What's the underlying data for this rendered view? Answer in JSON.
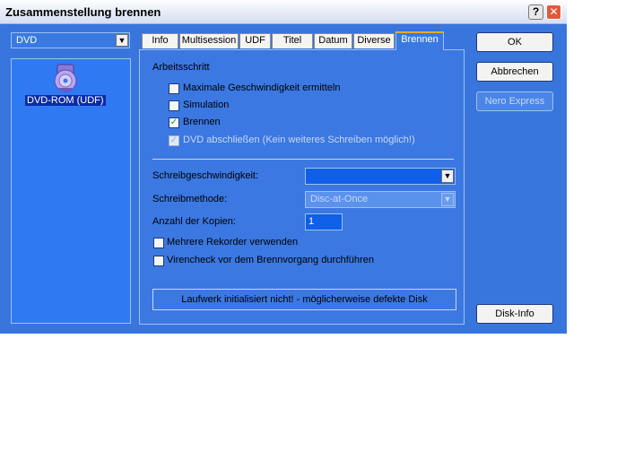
{
  "window": {
    "title": "Zusammenstellung brennen"
  },
  "drive_select": {
    "value": "DVD"
  },
  "disk_list": {
    "items": [
      {
        "label": "DVD-ROM (UDF)"
      }
    ]
  },
  "tabs": [
    {
      "label": "Info"
    },
    {
      "label": "Multisession"
    },
    {
      "label": "UDF"
    },
    {
      "label": "Titel"
    },
    {
      "label": "Datum"
    },
    {
      "label": "Diverse"
    },
    {
      "label": "Brennen",
      "active": true
    }
  ],
  "brennen": {
    "section_label": "Arbeitsschritt",
    "checkboxes": [
      {
        "label": "Maximale Geschwindigkeit ermitteln",
        "checked": false
      },
      {
        "label": "Simulation",
        "checked": false
      },
      {
        "label": "Brennen",
        "checked": true
      },
      {
        "label": "DVD abschließen (Kein weiteres Schreiben möglich!)",
        "checked": true,
        "disabled": true
      }
    ],
    "write_speed_label": "Schreibgeschwindigkeit:",
    "write_speed_value": "",
    "write_method_label": "Schreibmethode:",
    "write_method_value": "Disc-at-Once",
    "copies_label": "Anzahl der Kopien:",
    "copies_value": "1",
    "multi_recorder_label": "Mehrere Rekorder verwenden",
    "virus_check_label": "Virencheck vor dem Brennvorgang durchführen",
    "status_text": "Laufwerk initialisiert nicht! - möglicherweise defekte Disk"
  },
  "buttons": {
    "ok": "OK",
    "cancel": "Abbrechen",
    "nero_express": "Nero Express",
    "disk_info": "Disk-Info"
  },
  "colors": {
    "dialog_bg": "#3875dc",
    "active_tab_accent": "#e8a830",
    "selection_bg": "#0b2ca8"
  }
}
